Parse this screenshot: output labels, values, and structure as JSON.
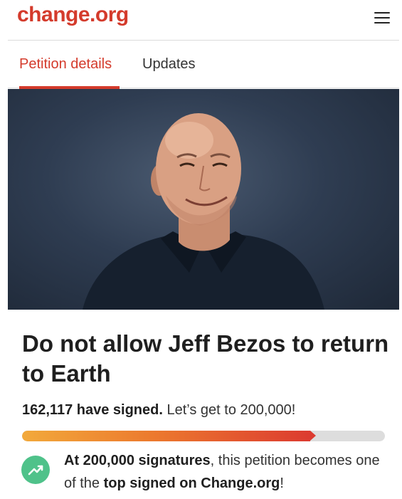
{
  "header": {
    "logo": "change.org",
    "menu_icon": "hamburger-menu-icon"
  },
  "tabs": [
    {
      "label": "Petition details",
      "active": true
    },
    {
      "label": "Updates",
      "active": false
    }
  ],
  "petition": {
    "title": "Do not allow Jeff Bezos to return to Earth",
    "signed_count": "162,117 have signed.",
    "goal_text": " Let’s get to 200,000!",
    "progress_fraction": 0.81,
    "milestone": {
      "icon": "trending-up-icon",
      "strong1": "At 200,000 signatures",
      "text1": ", this petition becomes one of the ",
      "strong2": "top signed on Change.org",
      "text2": "!"
    }
  },
  "colors": {
    "brand": "#d43b2c",
    "progress_start": "#f2a93b",
    "progress_end": "#dc3b30",
    "milestone_green": "#4fc28a"
  }
}
